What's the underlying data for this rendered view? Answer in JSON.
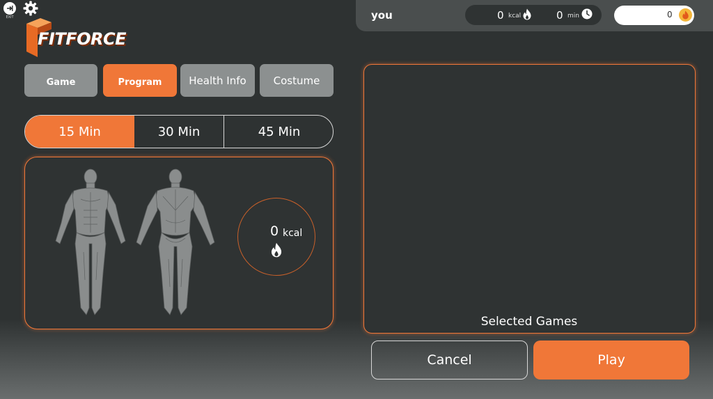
{
  "app": {
    "exit_label": "EXIT",
    "logo_text": "FITFORCE",
    "brand_color": "#f07738",
    "icons": {
      "exit": "exit-arrow-icon",
      "settings": "gear-icon",
      "kcal": "flame-icon",
      "time": "clock-icon",
      "coin": "coin-flame-icon"
    }
  },
  "top_bar": {
    "user_name": "you",
    "kcal_value": "0",
    "kcal_unit": "kcal",
    "min_value": "0",
    "min_unit": "min",
    "coins": "0"
  },
  "tabs": [
    {
      "label": "Game",
      "active": false
    },
    {
      "label": "Program",
      "active": true
    },
    {
      "label": "Health Info",
      "active": false
    },
    {
      "label": "Costume",
      "active": false
    }
  ],
  "durations": [
    {
      "label": "15 Min",
      "active": true
    },
    {
      "label": "30 Min",
      "active": false
    },
    {
      "label": "45 Min",
      "active": false
    }
  ],
  "body_panel": {
    "kcal_value": "0",
    "kcal_unit": "kcal"
  },
  "games_panel": {
    "label": "Selected Games"
  },
  "actions": {
    "cancel_label": "Cancel",
    "play_label": "Play"
  }
}
